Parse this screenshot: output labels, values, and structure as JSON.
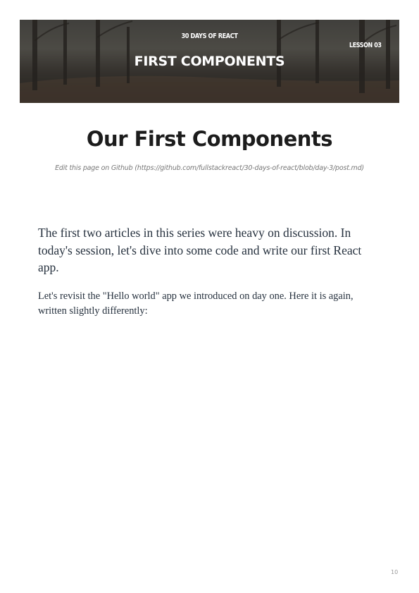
{
  "banner": {
    "series": "30 DAYS OF REACT",
    "title": "FIRST COMPONENTS",
    "lesson": "LESSON 03"
  },
  "page": {
    "title": "Our First Components",
    "edit_link": "Edit this page on Github (https://github.com/fullstackreact/30-days-of-react/blob/day-3/post.md)",
    "intro": "The first two articles in this series were heavy on discussion. In today's session, let's dive into some code and write our first React app.",
    "body": "Let's revisit the \"Hello world\" app we introduced on day one. Here it is again, written slightly differently:",
    "page_number": "10"
  }
}
